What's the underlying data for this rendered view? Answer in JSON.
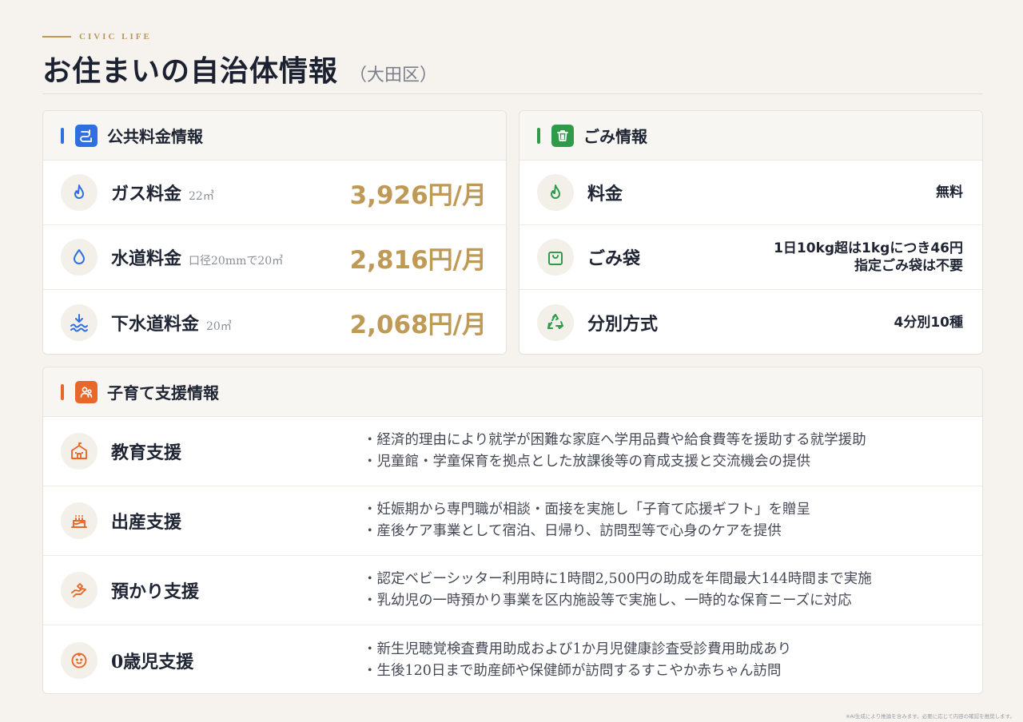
{
  "header": {
    "eyebrow": "CIVIC LIFE",
    "title": "お住まいの自治体情報",
    "subtitle": "（大田区）"
  },
  "utilities": {
    "title": "公共料金情報",
    "accent": "#2f6fe0",
    "items": [
      {
        "label": "ガス料金",
        "note": "22㎥",
        "price": "3,926円/月",
        "icon": "flame-icon"
      },
      {
        "label": "水道料金",
        "note": "口径20mmで20㎥",
        "price": "2,816円/月",
        "icon": "water-drop-icon"
      },
      {
        "label": "下水道料金",
        "note": "20㎥",
        "price": "2,068円/月",
        "icon": "sewer-icon"
      }
    ]
  },
  "garbage": {
    "title": "ごみ情報",
    "accent": "#2e9a4a",
    "items": [
      {
        "label": "料金",
        "value": "無料",
        "icon": "flame-icon"
      },
      {
        "label": "ごみ袋",
        "value_line1": "1日10kg超は1kgにつき46円",
        "value_line2": "指定ごみ袋は不要",
        "icon": "bag-icon"
      },
      {
        "label": "分別方式",
        "value": "4分別10種",
        "icon": "recycle-icon"
      }
    ]
  },
  "childcare": {
    "title": "子育て支援情報",
    "accent": "#e8672a",
    "items": [
      {
        "label": "教育支援",
        "icon": "school-icon",
        "line1": "・経済的理由により就学が困難な家庭へ学用品費や給食費等を援助する就学援助",
        "line2": "・児童館・学童保育を拠点とした放課後等の育成支援と交流機会の提供"
      },
      {
        "label": "出産支援",
        "icon": "cake-icon",
        "line1": "・妊娠期から専門職が相談・面接を実施し「子育て応援ギフト」を贈呈",
        "line2": "・産後ケア事業として宿泊、日帰り、訪問型等で心身のケアを提供"
      },
      {
        "label": "預かり支援",
        "icon": "hand-care-icon",
        "line1": "・認定ベビーシッター利用時に1時間2,500円の助成を年間最大144時間まで実施",
        "line2": "・乳幼児の一時預かり事業を区内施設等で実施し、一時的な保育ニーズに対応"
      },
      {
        "label": "0歳児支援",
        "icon": "baby-icon",
        "line1": "・新生児聴覚検査費用助成および1か月児健康診査受診費用助成あり",
        "line2": "・生後120日まで助産師や保健師が訪問するすこやか赤ちゃん訪問"
      }
    ]
  },
  "footnote": "※AI生成により推論を含みます。必要に応じて内容の確認を推奨します。"
}
